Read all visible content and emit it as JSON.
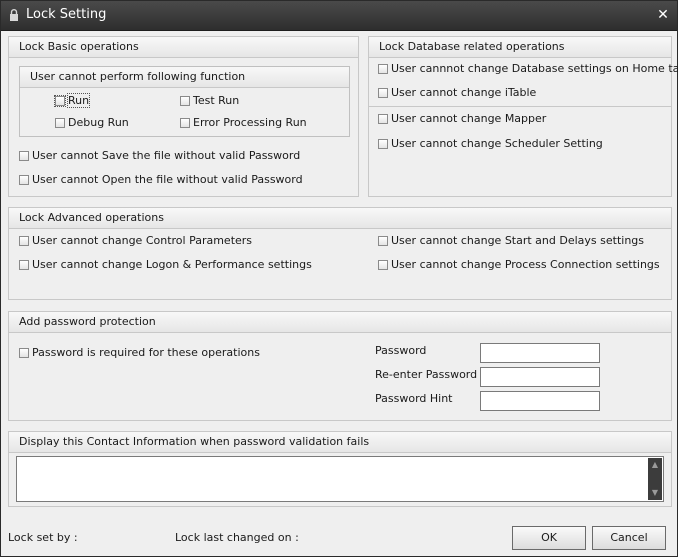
{
  "window": {
    "title": "Lock Setting",
    "close_glyph": "✕"
  },
  "basic": {
    "title": "Lock Basic operations",
    "inner_title": "User cannot perform following function",
    "run": "Run",
    "test_run": "Test Run",
    "debug_run": "Debug Run",
    "error_processing_run": "Error Processing Run",
    "save_without_password": "User cannot Save the file without valid Password",
    "open_without_password": "User cannot Open the file without valid Password"
  },
  "database": {
    "title": "Lock Database related operations",
    "db_settings_home": "User cannnot change Database settings on Home tab",
    "itable": "User cannot change iTable",
    "mapper": "User cannot change Mapper",
    "scheduler": "User cannot change Scheduler Setting"
  },
  "advanced": {
    "title": "Lock Advanced operations",
    "control_parameters": "User cannot change Control Parameters",
    "logon_performance": "User cannot change Logon & Performance settings",
    "start_delays": "User cannot change Start and Delays settings",
    "process_connection": "User cannot change Process Connection settings"
  },
  "password": {
    "title": "Add password protection",
    "required_checkbox": "Password is required for these operations",
    "password_label": "Password",
    "reenter_label": "Re-enter Password",
    "hint_label": "Password Hint",
    "password_value": "",
    "reenter_value": "",
    "hint_value": ""
  },
  "contact": {
    "title": "Display this Contact Information when password validation fails",
    "text": ""
  },
  "footer": {
    "lock_set_by": "Lock set by :",
    "lock_last_changed": "Lock last changed on :",
    "ok": "OK",
    "cancel": "Cancel"
  },
  "icons": {
    "title": "lock-icon",
    "close": "close-icon",
    "scroll_up": "scroll-up-arrow",
    "scroll_down": "scroll-down-arrow"
  }
}
